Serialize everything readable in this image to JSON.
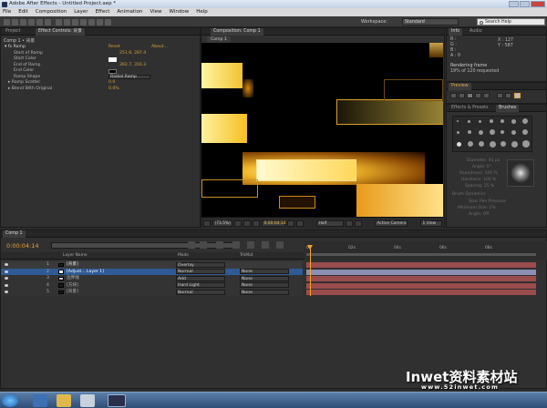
{
  "window": {
    "title": "Adobe After Effects - Untitled Project.aep *"
  },
  "menu": [
    "File",
    "Edit",
    "Composition",
    "Layer",
    "Effect",
    "Animation",
    "View",
    "Window",
    "Help"
  ],
  "toolbar": {
    "workspace_label": "Workspace:",
    "workspace_value": "Standard",
    "search_placeholder": "Search Help"
  },
  "left_panel": {
    "tabs": [
      "Project",
      "Effect Controls: 背景"
    ],
    "breadcrumb": "Comp 1 • 背景",
    "effect": {
      "name": "Ramp",
      "reset_label": "Reset",
      "about_label": "About...",
      "properties": [
        {
          "name": "Start of Ramp",
          "value": "251.6, 287.4"
        },
        {
          "name": "Start Color",
          "value": ""
        },
        {
          "name": "End of Ramp",
          "value": "392.7, 316.3"
        },
        {
          "name": "End Color",
          "value": ""
        },
        {
          "name": "Ramp Shape",
          "value": "Radial Ramp"
        },
        {
          "name": "Ramp Scatter",
          "value": "0.0"
        },
        {
          "name": "Blend With Original",
          "value": "0.0%"
        }
      ]
    }
  },
  "viewer": {
    "tab": "Composition: Comp 1",
    "sub_tab": "Comp 1",
    "bottom": {
      "zoom": "(73.5%)",
      "timecode": "0:00:04:14",
      "resolution": "Half",
      "camera": "Active Camera",
      "views": "1 View"
    }
  },
  "info_panel": {
    "tabs": [
      "Info",
      "Audio"
    ],
    "channels": {
      "R": "R :",
      "G": "G :",
      "B": "B :",
      "A": "A : 0"
    },
    "x": "X : 127",
    "y": "Y : 587",
    "status1": "Rendering frame",
    "status2": "19% of 120 requested"
  },
  "preview_panel": {
    "tab": "Preview"
  },
  "effects_panel": {
    "tabs": [
      "Effects & Presets",
      "Brushes"
    ],
    "rows": [
      "Diameter: 91 px",
      "Angle: 0°",
      "Roundness: 100 %",
      "Hardness: 100 %",
      "Spacing: 25 %",
      "Brush Dynamics",
      "Size: Pen Pressure",
      "Minimum Size: 1%",
      "Angle: Off"
    ]
  },
  "timeline": {
    "tab": "Comp 1",
    "timecode": "0:00:04:14",
    "search_placeholder": "",
    "columns": {
      "layer_name": "Layer Name",
      "mode": "Mode",
      "trkmat": "TrkMat"
    },
    "ruler": [
      "0s",
      "02s",
      "04s",
      "06s",
      "08s"
    ],
    "layers": [
      {
        "num": "1",
        "name": "[背景]",
        "mode": "Overlay",
        "trkmat": "",
        "swatch": "#1c1c1c",
        "track_color": "#9b4c4c"
      },
      {
        "num": "2",
        "name": "[Adjust... Layer 1]",
        "mode": "Normal",
        "trkmat": "None",
        "swatch": "#ffffff",
        "track_color": "#8c8fb3"
      },
      {
        "num": "3",
        "name": "边界线",
        "mode": "Add",
        "trkmat": "None",
        "swatch": "#c8c8c8",
        "track_color": "#9b4c4c"
      },
      {
        "num": "4",
        "name": "[方块]",
        "mode": "Hard Light",
        "trkmat": "None",
        "swatch": "#1c1c1c",
        "track_color": "#9b4c4c"
      },
      {
        "num": "5",
        "name": "[背景]",
        "mode": "Normal",
        "trkmat": "None",
        "swatch": "#1c1c1c",
        "track_color": "#9b4c4c"
      }
    ]
  },
  "watermark": {
    "main": "Inwet资料素材站",
    "url": "www.52inwet.com"
  },
  "colors": {
    "accent_orange": "#e3a33a",
    "selected_blue": "#2e5a95",
    "playhead": "#f5a623"
  }
}
